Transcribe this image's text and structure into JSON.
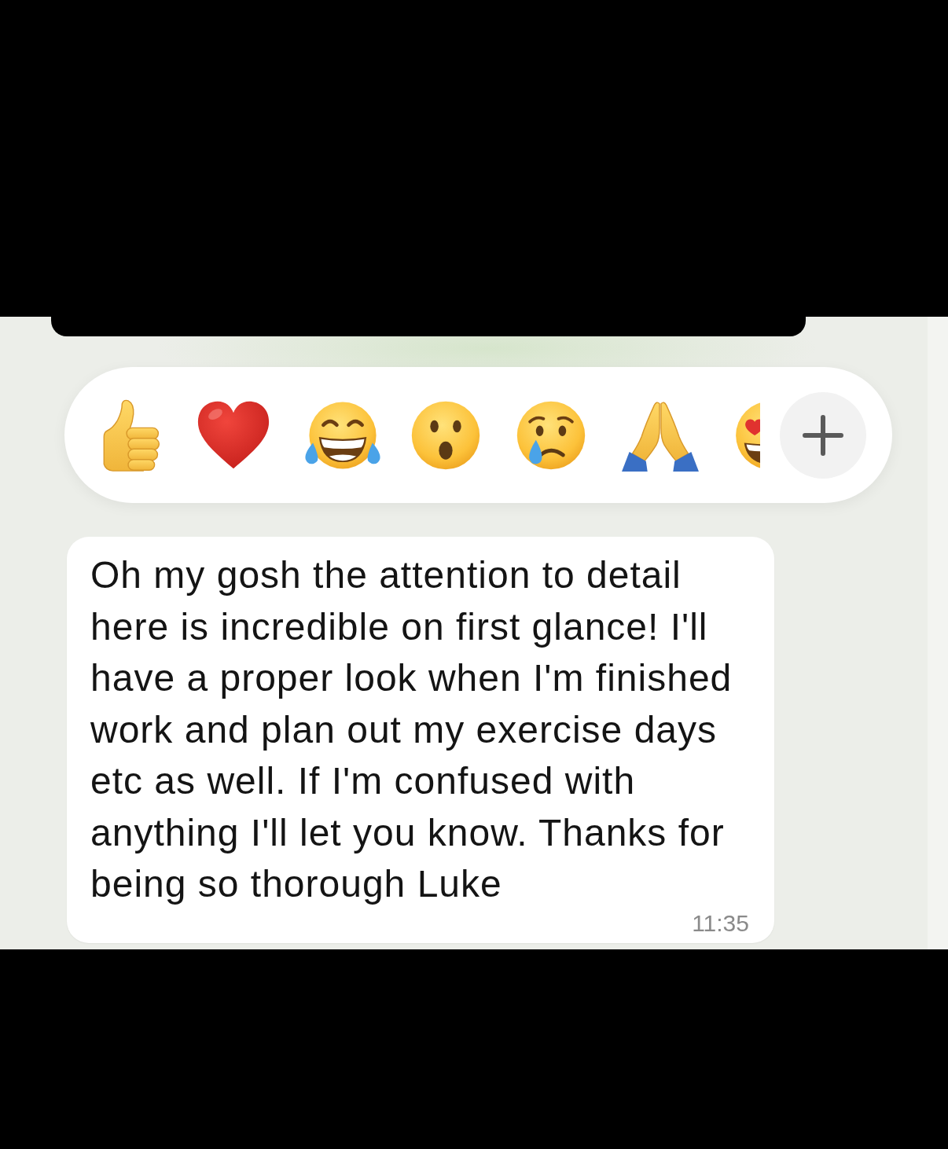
{
  "message": {
    "text": "Oh my gosh the attention to detail here is incredible on first glance! I'll have a proper look when I'm finished work and plan out my exercise days etc as well. If I'm confused with anything I'll let you know. Thanks for being so thorough Luke",
    "time": "11:35"
  }
}
